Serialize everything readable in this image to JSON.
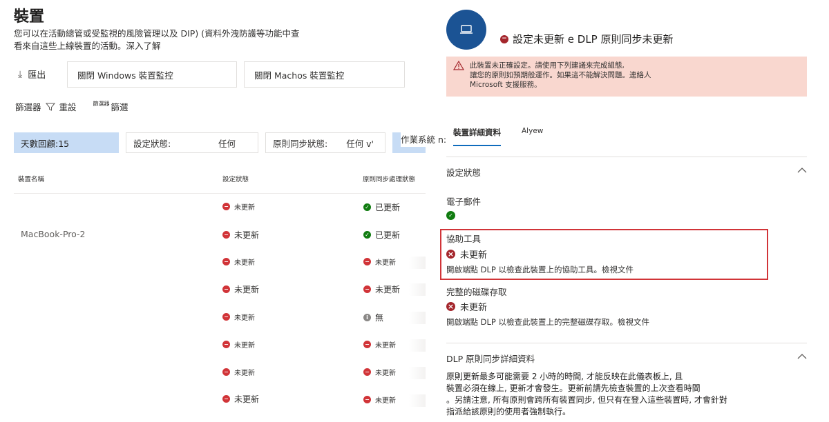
{
  "page": {
    "title": "裝置",
    "description": "您可以在活動總管或受監視的風險管理以及 DIP) (資料外洩防護等功能中查看來自這些上線裝置的活動。深入了解"
  },
  "toolbar": {
    "export_label": "匯出",
    "windows_monitor_label": "關閉 Windows 裝置監控",
    "macos_monitor_label": "關閉 Machos 裝置監控"
  },
  "filters": {
    "filter_label": "篩選器",
    "reset_label": "重設",
    "small_label": "篩選器",
    "filter_small2": "篩選",
    "days_chip": "天數回顧:15",
    "config_status_label": "設定狀態:",
    "config_status_value": "任何",
    "policy_sync_label": "原則同步狀態:",
    "policy_sync_value": "任何 v'",
    "os_label": "作業系統 n:"
  },
  "table": {
    "headers": [
      "裝置名稱",
      "設定狀態",
      "原則同步處理狀態"
    ],
    "device_name": "MacBook-Pro-2",
    "rows": [
      {
        "config": "未更新",
        "policy": "已更新"
      },
      {
        "config": "未更新",
        "policy": "已更新"
      },
      {
        "config": "未更新",
        "policy": "未更新"
      },
      {
        "config": "未更新",
        "policy": "未更新"
      },
      {
        "config": "未更新",
        "policy": "無"
      },
      {
        "config": "未更新",
        "policy": "未更新"
      },
      {
        "config": "未更新",
        "policy": "未更新"
      },
      {
        "config": "未更新",
        "policy": "未更新"
      }
    ]
  },
  "panel": {
    "title": "設定未更新 e DLP 原則同步未更新",
    "warning": "此裝置未正確設定。請使用下列建議來完成組態,讓您的原則如預期般運作。如果這不能解決問題,連絡人 Microsoft 支援服務。",
    "warning_lines": [
      "此裝置未正確設定。請使用下列建議來完成組態,",
      "讓您的原則如預期般運作。如果這不能解決問題。連絡人",
      "Microsoft 支援服務。"
    ],
    "tabs": [
      "裝置詳細資料",
      "Alyew"
    ],
    "config_section": "設定狀態",
    "email_title": "電子郵件",
    "assist_title": "協助工具",
    "assist_status": "未更新",
    "assist_desc": "開啟端點 DLP 以檢查此裝置上的協助工具。檢視文件",
    "disk_title": "完整的磁碟存取",
    "disk_status": "未更新",
    "disk_desc": "開啟端點 DLP 以檢查此裝置上的完整磁碟存取。檢視文件",
    "sync_section": "DLP 原則同步詳細資料",
    "sync_lines": [
      "原則更新最多可能需要 2 小時的時間, 才能反映在此儀表板上, 且",
      "裝置必須在線上, 更新才會發生。更新前請先檢查裝置的上次查看時間",
      "。另請注意, 所有原則會跨所有裝置同步, 但只有在登入這些裝置時, 才會針對",
      "指派給該原則的使用者強制執行。"
    ]
  },
  "colors": {
    "accent": "#0f6cbd",
    "avatar": "#1b5394",
    "error": "#a4262c",
    "success": "#107c10",
    "warning_bg": "#f9d7cf",
    "chip_blue": "#c7dcf5",
    "highlight": "#d13438"
  }
}
